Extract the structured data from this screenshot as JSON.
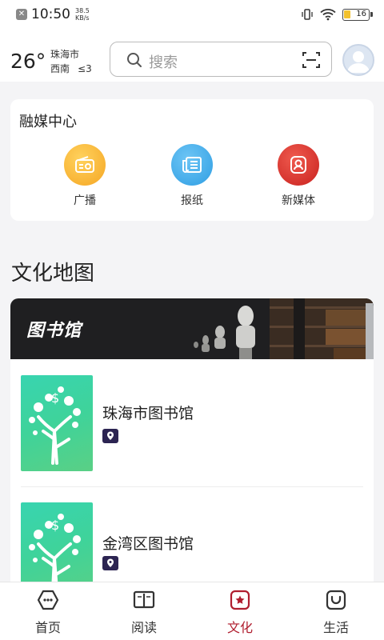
{
  "status_bar": {
    "time": "10:50",
    "speed_value": "38.5",
    "speed_unit": "KB/s",
    "battery": "16"
  },
  "header": {
    "temperature": "26°",
    "city": "珠海市",
    "wind_direction": "西南",
    "wind_level": "≤3",
    "search_placeholder": "搜索"
  },
  "media_center": {
    "title": "融媒中心",
    "items": [
      {
        "label": "广播",
        "icon": "radio-icon",
        "color": "#f5a623"
      },
      {
        "label": "报纸",
        "icon": "newspaper-icon",
        "color": "#2f9ee3"
      },
      {
        "label": "新媒体",
        "icon": "new-media-icon",
        "color": "#d32a2a"
      }
    ]
  },
  "culture_map": {
    "title": "文化地图",
    "banner_title": "图书馆",
    "libraries": [
      {
        "name": "珠海市图书馆"
      },
      {
        "name": "金湾区图书馆"
      }
    ]
  },
  "bottom_nav": {
    "items": [
      {
        "label": "首页",
        "icon": "home-icon",
        "active": false
      },
      {
        "label": "阅读",
        "icon": "book-icon",
        "active": false
      },
      {
        "label": "文化",
        "icon": "culture-star-icon",
        "active": true
      },
      {
        "label": "生活",
        "icon": "life-icon",
        "active": false
      }
    ],
    "active_color": "#b01e2f"
  }
}
